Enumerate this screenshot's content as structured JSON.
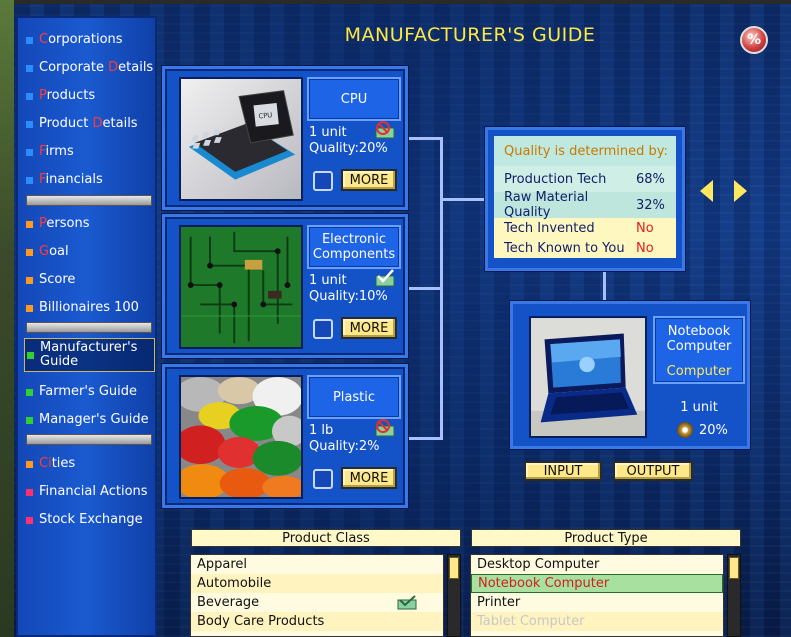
{
  "title": "MANUFACTURER'S GUIDE",
  "percent_icon_label": "%",
  "sidebar": {
    "items": [
      {
        "first": "C",
        "rest": "orporations",
        "color": "#2a8cff"
      },
      {
        "first": "Corporate ",
        "hot": "D",
        "rest": "etails",
        "color": "#2a8cff"
      },
      {
        "first": "P",
        "rest": "roducts",
        "color": "#2a8cff"
      },
      {
        "first": "Product ",
        "hot": "D",
        "rest": "etails",
        "color": "#2a8cff"
      },
      {
        "first": "F",
        "rest": "irms",
        "color": "#2a8cff"
      },
      {
        "first": "F",
        "rest": "inancials",
        "color": "#2a8cff"
      },
      {
        "first": "P",
        "rest": "ersons",
        "color": "#ff9a20"
      },
      {
        "first": "G",
        "rest": "oal",
        "color": "#ff9a20"
      },
      {
        "first": "",
        "rest": "Score",
        "color": "#ff9a20"
      },
      {
        "first": "",
        "rest": "Billionaires 100",
        "color": "#ff9a20"
      },
      {
        "first": "",
        "rest": "Manufacturer's Guide",
        "color": "#30d030"
      },
      {
        "first": "",
        "rest": "Farmer's Guide",
        "color": "#30d030"
      },
      {
        "first": "",
        "rest": "Manager's Guide",
        "color": "#30d030"
      },
      {
        "first": "Ci",
        "rest": "ties",
        "color": "#ff9a20"
      },
      {
        "first": "",
        "rest": "Financial Actions",
        "color": "#ff3070"
      },
      {
        "first": "",
        "rest": "Stock Exchange",
        "color": "#ff3070"
      }
    ]
  },
  "inputs": [
    {
      "name": "CPU",
      "unit": "1 unit",
      "quality_label": "Quality:",
      "quality": "20%",
      "more": "MORE"
    },
    {
      "name": "Electronic Components",
      "unit": "1 unit",
      "quality_label": "Quality:",
      "quality": "10%",
      "more": "MORE"
    },
    {
      "name": "Plastic",
      "unit": "1 lb",
      "quality_label": "Quality:",
      "quality": "2%",
      "more": "MORE"
    }
  ],
  "quality_panel": {
    "heading": "Quality is determined by:",
    "rows": [
      {
        "label": "Production Tech",
        "value": "68%"
      },
      {
        "label": "Raw Material Quality",
        "value": "32%"
      },
      {
        "label": "Tech Invented",
        "value": "No"
      },
      {
        "label": "Tech Known to You",
        "value": "No"
      }
    ]
  },
  "output": {
    "name": "Notebook Computer",
    "class": "Computer",
    "unit": "1 unit",
    "quality": "20%"
  },
  "buttons": {
    "input": "INPUT",
    "output": "OUTPUT"
  },
  "product_class": {
    "header": "Product Class",
    "items": [
      "Apparel",
      "Automobile",
      "Beverage",
      "Body Care Products"
    ]
  },
  "product_type": {
    "header": "Product Type",
    "items": [
      "Desktop Computer",
      "Notebook Computer",
      "Printer",
      "Tablet Computer"
    ],
    "selected": "Notebook Computer"
  }
}
